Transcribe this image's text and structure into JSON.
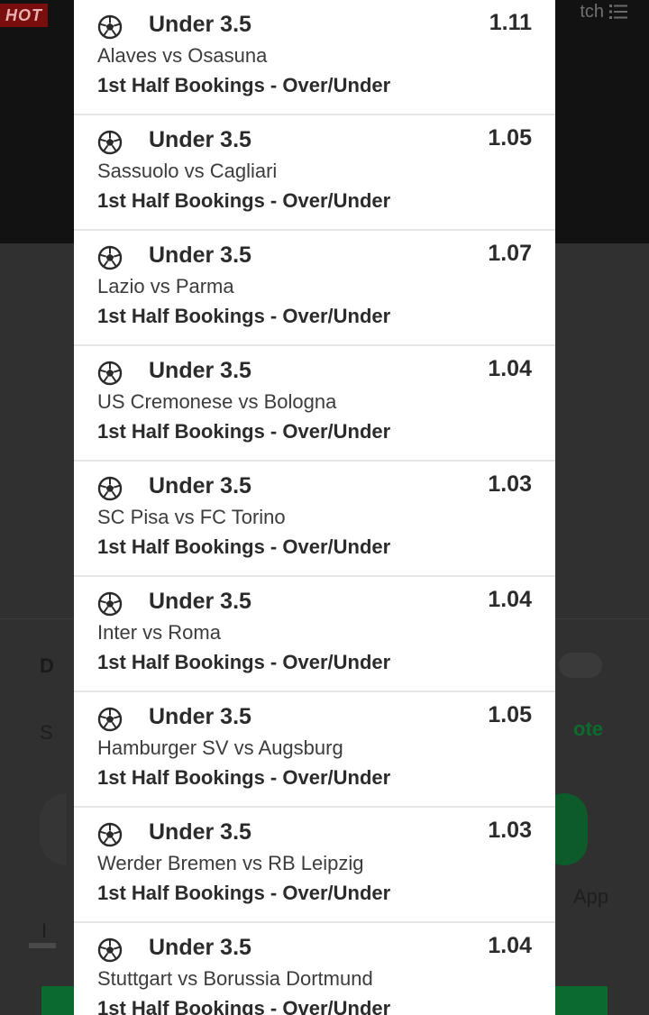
{
  "background": {
    "hot_badge": "HOT",
    "search_text": "tch",
    "left_letter_1": "D",
    "left_letter_2": "S",
    "left_letter_3": "I",
    "right_text_1": "ote",
    "right_text_2": "App",
    "colors": {
      "green": "#0a6a2f",
      "link_green": "#0c6b2e"
    }
  },
  "bets": [
    {
      "selection": "Under 3.5",
      "odds": "1.11",
      "match": "Alaves vs Osasuna",
      "market": "1st Half Bookings - Over/Under"
    },
    {
      "selection": "Under 3.5",
      "odds": "1.05",
      "match": "Sassuolo vs Cagliari",
      "market": "1st Half Bookings - Over/Under"
    },
    {
      "selection": "Under 3.5",
      "odds": "1.07",
      "match": "Lazio vs Parma",
      "market": "1st Half Bookings - Over/Under"
    },
    {
      "selection": "Under 3.5",
      "odds": "1.04",
      "match": "US Cremonese vs Bologna",
      "market": "1st Half Bookings - Over/Under"
    },
    {
      "selection": "Under 3.5",
      "odds": "1.03",
      "match": "SC Pisa vs FC Torino",
      "market": "1st Half Bookings - Over/Under"
    },
    {
      "selection": "Under 3.5",
      "odds": "1.04",
      "match": "Inter vs Roma",
      "market": "1st Half Bookings - Over/Under"
    },
    {
      "selection": "Under 3.5",
      "odds": "1.05",
      "match": "Hamburger SV vs Augsburg",
      "market": "1st Half Bookings - Over/Under"
    },
    {
      "selection": "Under 3.5",
      "odds": "1.03",
      "match": "Werder Bremen vs RB Leipzig",
      "market": "1st Half Bookings - Over/Under"
    },
    {
      "selection": "Under 3.5",
      "odds": "1.04",
      "match": "Stuttgart vs Borussia Dortmund",
      "market": "1st Half Bookings - Over/Under"
    }
  ],
  "icons": {
    "sport": "soccer-ball-icon"
  }
}
